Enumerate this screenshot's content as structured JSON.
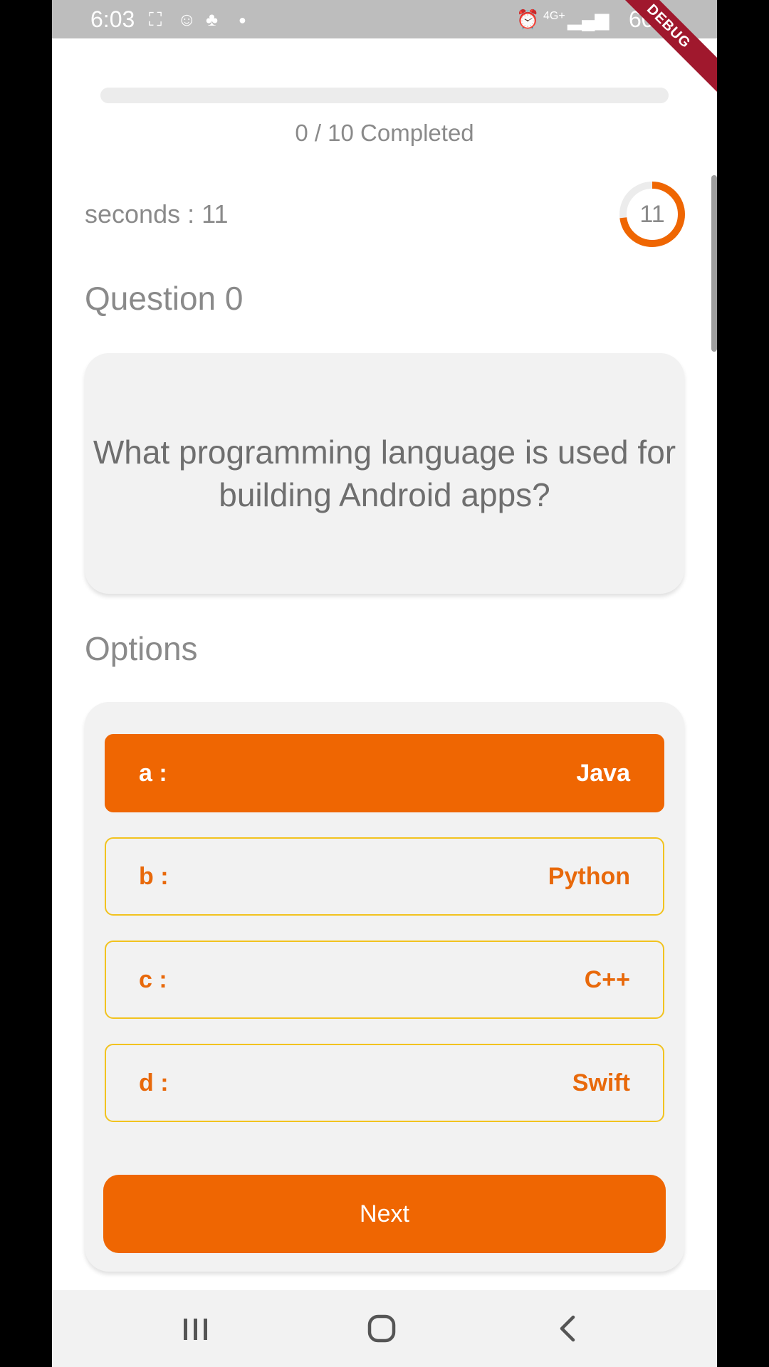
{
  "status_bar": {
    "time": "6:03",
    "battery": "60%",
    "debug_label": "DEBUG"
  },
  "progress": {
    "completed": 0,
    "total": 10,
    "fraction": 0.0,
    "label": "0 / 10 Completed"
  },
  "timer": {
    "seconds_label": "seconds : 11",
    "value": "11",
    "remaining_fraction": 0.73,
    "accent_color": "#ef6602"
  },
  "question": {
    "heading": "Question 0",
    "text": "What programming language is used for building Android apps?"
  },
  "options_section": {
    "heading": "Options",
    "selected_index": 0,
    "items": [
      {
        "letter": "a :",
        "answer": "Java"
      },
      {
        "letter": "b :",
        "answer": "Python"
      },
      {
        "letter": "c :",
        "answer": "C++"
      },
      {
        "letter": "d :",
        "answer": "Swift"
      }
    ]
  },
  "next_button": {
    "label": "Next"
  },
  "colors": {
    "accent": "#ef6602",
    "option_border": "#f2c31f",
    "card_bg": "#f2f2f2",
    "text_gray": "#8a8a8a"
  },
  "icons": {
    "nav_recents": "recents-icon",
    "nav_home": "home-icon",
    "nav_back": "back-icon"
  }
}
